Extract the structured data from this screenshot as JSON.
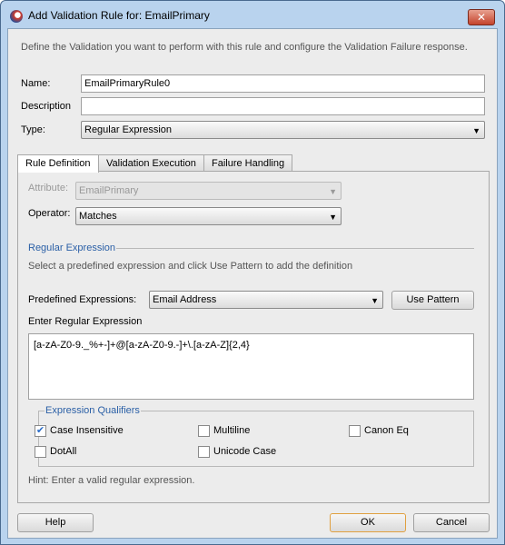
{
  "window": {
    "title": "Add Validation Rule for: EmailPrimary",
    "close_icon": "close-icon"
  },
  "intro": "Define the Validation you want to perform with this rule and configure the Validation Failure response.",
  "form": {
    "name_label": "Name:",
    "name_value": "EmailPrimaryRule0",
    "description_label": "Description",
    "description_value": "",
    "type_label": "Type:",
    "type_value": "Regular Expression"
  },
  "tabs": [
    {
      "label": "Rule Definition",
      "active": true
    },
    {
      "label": "Validation Execution"
    },
    {
      "label": "Failure Handling"
    }
  ],
  "rule": {
    "attribute_label": "Attribute:",
    "attribute_value": "EmailPrimary",
    "operator_label": "Operator:",
    "operator_value": "Matches",
    "section_title": "Regular Expression",
    "section_help": "Select a predefined expression and click Use Pattern to add the definition",
    "predefined_label": "Predefined Expressions:",
    "predefined_value": "Email Address",
    "use_pattern": "Use Pattern",
    "enter_label": "Enter Regular Expression",
    "regex": "[a-zA-Z0-9._%+-]+@[a-zA-Z0-9.-]+\\.[a-zA-Z]{2,4}",
    "qualifiers_title": "Expression Qualifiers",
    "qualifiers": [
      {
        "label": "Case Insensitive",
        "checked": true
      },
      {
        "label": "Multiline",
        "checked": false
      },
      {
        "label": "Canon Eq",
        "checked": false
      },
      {
        "label": "DotAll",
        "checked": false
      },
      {
        "label": "Unicode Case",
        "checked": false
      }
    ],
    "hint": "Hint: Enter a valid regular expression."
  },
  "buttons": {
    "help": "Help",
    "ok": "OK",
    "cancel": "Cancel"
  },
  "colors": {
    "accent": "#2a5fa6",
    "frame": "#b9d3ee",
    "default_button_border": "#e0a040"
  }
}
